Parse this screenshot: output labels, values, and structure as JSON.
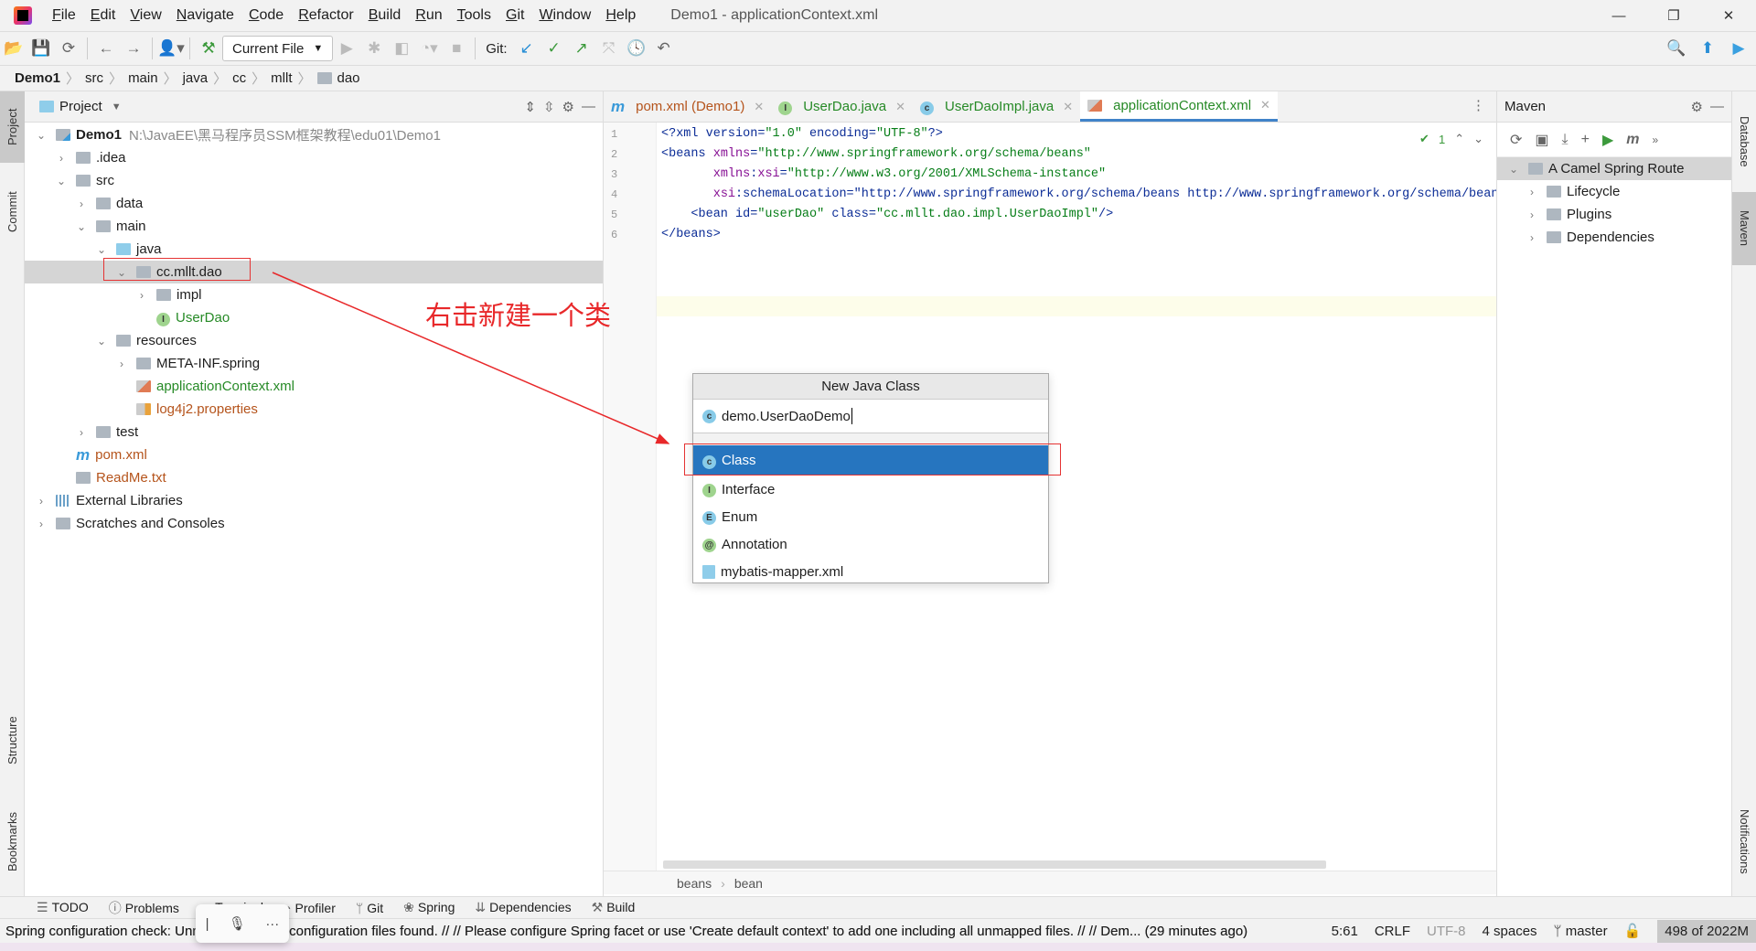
{
  "menubar": {
    "items": [
      "File",
      "Edit",
      "View",
      "Navigate",
      "Code",
      "Refactor",
      "Build",
      "Run",
      "Tools",
      "Git",
      "Window",
      "Help"
    ],
    "window_title": "Demo1 - applicationContext.xml"
  },
  "toolbar": {
    "run_config": "Current File",
    "git_label": "Git:"
  },
  "breadcrumb": [
    "Demo1",
    "src",
    "main",
    "java",
    "cc",
    "mllt",
    "dao"
  ],
  "left_stripe": {
    "project": "Project",
    "commit": "Commit",
    "structure": "Structure",
    "bookmarks": "Bookmarks"
  },
  "right_stripe": {
    "database": "Database",
    "maven": "Maven",
    "notifications": "Notifications"
  },
  "project": {
    "title": "Project",
    "tree": [
      {
        "label": "Demo1",
        "path": "N:\\JavaEE\\黑马程序员SSM框架教程\\edu01\\Demo1",
        "depth": 0,
        "state": "open",
        "icon": "module-icon"
      },
      {
        "label": ".idea",
        "depth": 1,
        "state": "closed",
        "icon": "folder-icon"
      },
      {
        "label": "src",
        "depth": 1,
        "state": "open",
        "icon": "folder-icon"
      },
      {
        "label": "data",
        "depth": 2,
        "state": "closed",
        "icon": "folder-icon"
      },
      {
        "label": "main",
        "depth": 2,
        "state": "open",
        "icon": "folder-icon"
      },
      {
        "label": "java",
        "depth": 3,
        "state": "open",
        "icon": "source-folder-icon"
      },
      {
        "label": "cc.mllt.dao",
        "depth": 4,
        "state": "open",
        "icon": "package-icon",
        "selected": true
      },
      {
        "label": "impl",
        "depth": 5,
        "state": "closed",
        "icon": "package-icon"
      },
      {
        "label": "UserDao",
        "depth": 5,
        "icon": "interface-icon",
        "color": "green"
      },
      {
        "label": "resources",
        "depth": 3,
        "state": "open",
        "icon": "resources-folder-icon"
      },
      {
        "label": "META-INF.spring",
        "depth": 4,
        "state": "closed",
        "icon": "folder-icon"
      },
      {
        "label": "applicationContext.xml",
        "depth": 4,
        "icon": "spring-xml-icon",
        "color": "green"
      },
      {
        "label": "log4j2.properties",
        "depth": 4,
        "icon": "properties-icon",
        "color": "orange"
      },
      {
        "label": "test",
        "depth": 2,
        "state": "closed",
        "icon": "folder-icon"
      },
      {
        "label": "pom.xml",
        "depth": 1,
        "icon": "maven-icon",
        "color": "orange"
      },
      {
        "label": "ReadMe.txt",
        "depth": 1,
        "icon": "text-file-icon",
        "color": "orange"
      },
      {
        "label": "External Libraries",
        "depth": 0,
        "state": "closed",
        "icon": "libraries-icon"
      },
      {
        "label": "Scratches and Consoles",
        "depth": 0,
        "state": "closed",
        "icon": "scratches-icon"
      }
    ]
  },
  "editor": {
    "tabs": [
      {
        "label": "pom.xml (Demo1)",
        "icon": "maven-icon",
        "color": "orange"
      },
      {
        "label": "UserDao.java",
        "icon": "interface-icon",
        "color": "green"
      },
      {
        "label": "UserDaoImpl.java",
        "icon": "class-icon",
        "color": "green"
      },
      {
        "label": "applicationContext.xml",
        "icon": "spring-xml-icon",
        "color": "green",
        "active": true
      }
    ],
    "inspection_count": "1",
    "lines": [
      [
        "<?xml version=\"1.0\" encoding=\"UTF-8\"?>"
      ],
      [
        "<beans xmlns=\"http://www.springframework.org/schema/beans\""
      ],
      [
        "       xmlns:xsi=\"http://www.w3.org/2001/XMLSchema-instance\""
      ],
      [
        "       xsi:schemaLocation=\"http://www.springframework.org/schema/beans http://www.springframework.org/schema/beans"
      ],
      [
        "    <bean id=\"userDao\" class=\"cc.mllt.dao.impl.UserDaoImpl\"/>"
      ],
      [
        "</beans>"
      ]
    ],
    "line_numbers": [
      "1",
      "2",
      "3",
      "4",
      "5",
      "6"
    ],
    "breadcrumb": [
      "beans",
      "bean"
    ]
  },
  "maven": {
    "title": "Maven",
    "root": "A Camel Spring Route",
    "children": [
      "Lifecycle",
      "Plugins",
      "Dependencies"
    ]
  },
  "dialog": {
    "title": "New Java Class",
    "input_value": "demo.UserDaoDemo",
    "options": [
      {
        "label": "Class",
        "icon": "class-icon",
        "selected": true
      },
      {
        "label": "Interface",
        "icon": "interface-icon"
      },
      {
        "label": "Enum",
        "icon": "enum-icon"
      },
      {
        "label": "Annotation",
        "icon": "annotation-icon"
      },
      {
        "label": "mybatis-mapper.xml",
        "icon": "xml-template-icon"
      }
    ]
  },
  "annotation": "右击新建一个类",
  "annotation_color": "#e8282a",
  "bottom_tools": [
    "TODO",
    "Problems",
    "Terminal",
    "Profiler",
    "Git",
    "Spring",
    "Dependencies",
    "Build"
  ],
  "status": {
    "message": "Spring configuration check: Unmapped Spring configuration files found. // // Please configure Spring facet or use 'Create default context' to add one including all unmapped files. // // Dem... (29 minutes ago)",
    "message_visible_start": "Spring configuration check: Un",
    "message_visible_end": "g configuration files found. // // Please configure Spring facet or use 'Create default context' to add one including all unmapped files. // // Dem... (29 minutes ago)",
    "position": "5:61",
    "line_sep": "CRLF",
    "encoding": "UTF-8",
    "indent": "4 spaces",
    "branch": "master",
    "memory": "498 of 2022M"
  }
}
